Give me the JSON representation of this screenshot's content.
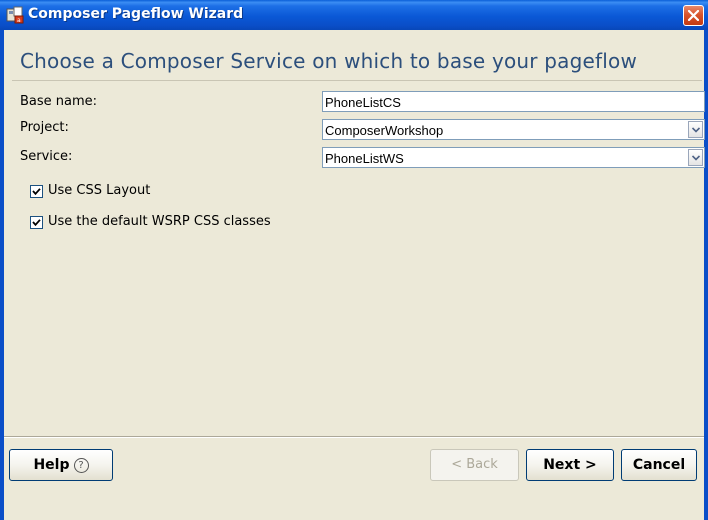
{
  "window": {
    "title": "Composer Pageflow Wizard",
    "accent": "#0a4ec8",
    "close_icon": "close-icon"
  },
  "main": {
    "heading": "Choose a Composer Service on which to base your pageflow",
    "fields": {
      "base_name": {
        "label": "Base name:",
        "value": "PhoneListCS"
      },
      "project": {
        "label": "Project:",
        "value": "ComposerWorkshop"
      },
      "service": {
        "label": "Service:",
        "value": "PhoneListWS"
      }
    },
    "checkboxes": {
      "use_css_layout": {
        "label": "Use CSS Layout",
        "checked": true
      },
      "use_wsrp_css": {
        "label": "Use the default WSRP CSS classes",
        "checked": true
      }
    }
  },
  "footer": {
    "help_label": "Help",
    "help_icon": "?",
    "back_label": "< Back",
    "next_label": "Next >",
    "cancel_label": "Cancel"
  }
}
